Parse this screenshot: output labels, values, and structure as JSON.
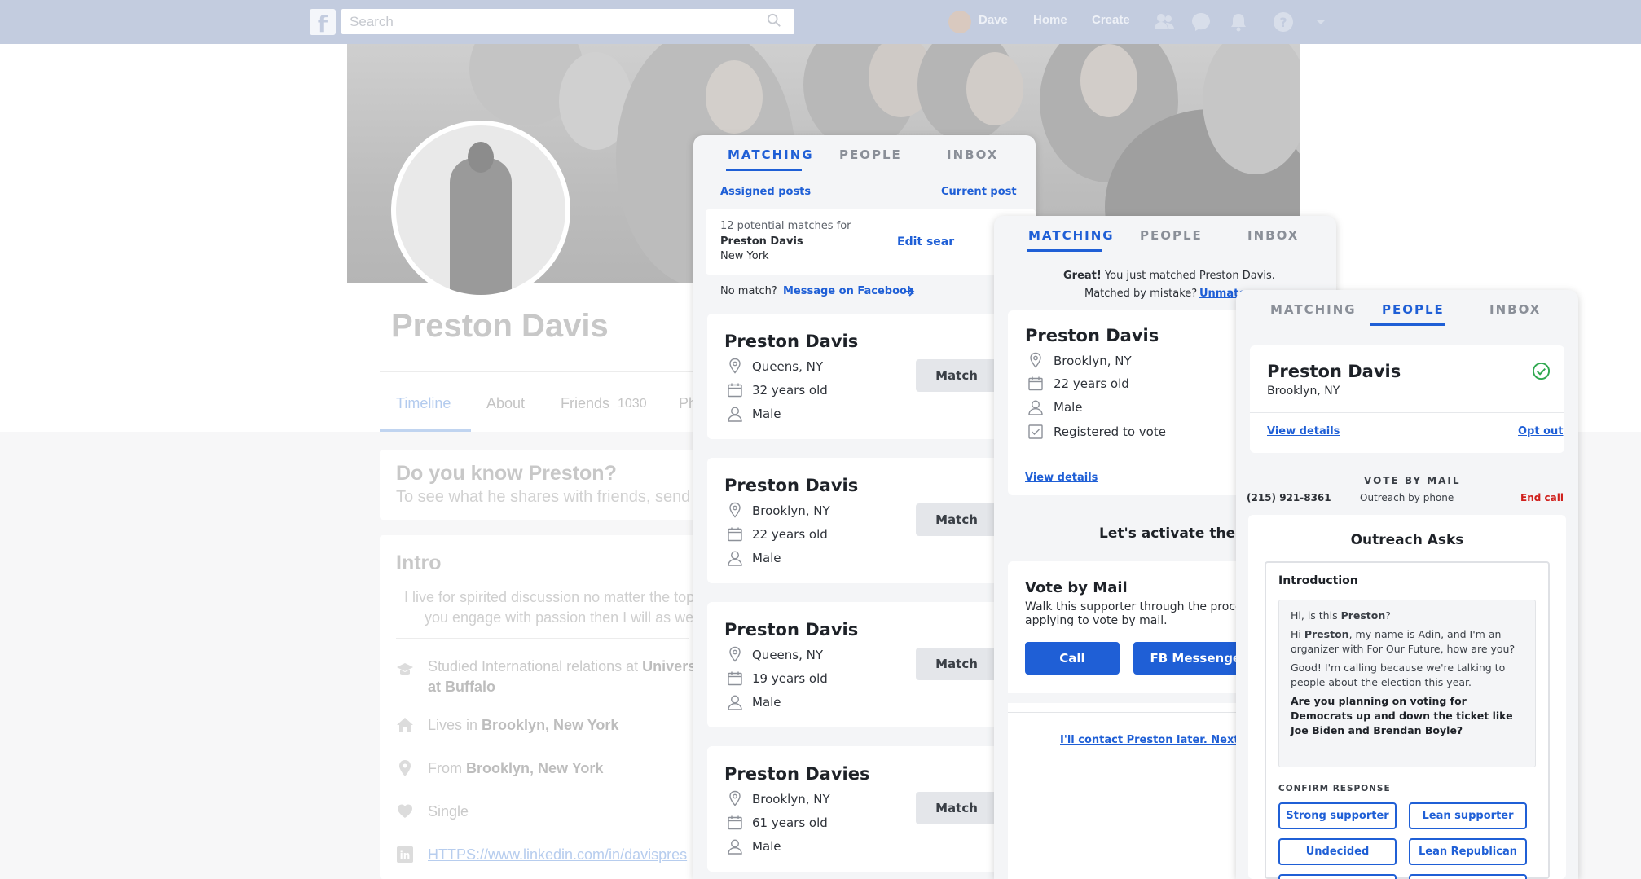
{
  "facebook": {
    "logo": "f",
    "search_placeholder": "Search",
    "nav_user": "Dave",
    "nav_home": "Home",
    "nav_create": "Create",
    "profile_name": "Preston Davis",
    "tabs": {
      "timeline": "Timeline",
      "about": "About",
      "friends": "Friends",
      "friends_count": "1030",
      "photos_partial": "Ph"
    },
    "know_title": "Do you know Preston?",
    "know_sub": "To see what he shares with friends, send",
    "intro_title": "Intro",
    "intro_line1": "I live for spirited discussion no matter the top",
    "intro_line2": "you engage with passion then I will as we",
    "studied_prefix": "Studied International relations at ",
    "studied_bold1": "Univers",
    "studied_bold2": "at Buffalo",
    "lives_prefix": "Lives in ",
    "lives_bold": "Brooklyn, New York",
    "from_prefix": "From ",
    "from_bold": "Brooklyn, New York",
    "relationship": "Single",
    "linkedin": "HTTPS://www.linkedin.com/in/davispres"
  },
  "panel1": {
    "tabs": [
      "MATCHING",
      "PEOPLE",
      "INBOX"
    ],
    "assigned_posts": "Assigned posts",
    "current_post": "Current post",
    "potential_matches": "12 potential matches for",
    "search_name": "Preston Davis",
    "search_city": "New York",
    "edit_search": "Edit sear",
    "no_match": "No match?",
    "message_fb": "Message on Facebook",
    "results": [
      {
        "name": "Preston Davis",
        "location": "Queens, NY",
        "age": "32 years old",
        "gender": "Male",
        "button": "Match"
      },
      {
        "name": "Preston Davis",
        "location": "Brooklyn, NY",
        "age": "22 years old",
        "gender": "Male",
        "button": "Match"
      },
      {
        "name": "Preston Davis",
        "location": "Queens, NY",
        "age": "19 years old",
        "gender": "Male",
        "button": "Match"
      },
      {
        "name": "Preston Davies",
        "location": "Brooklyn, NY",
        "age": "61 years old",
        "gender": "Male",
        "button": "Match"
      }
    ]
  },
  "panel2": {
    "tabs": [
      "MATCHING",
      "PEOPLE",
      "INBOX"
    ],
    "great": "Great!",
    "matched_msg": " You just matched Preston Davis.",
    "mistake": "Matched by mistake?",
    "unmatch": "Unmatc",
    "name": "Preston Davis",
    "location": "Brooklyn, NY",
    "age": "22 years old",
    "gender": "Male",
    "registered": "Registered to vote",
    "view_details": "View details",
    "activate_title": "Let's activate them",
    "vbm_title": "Vote by Mail",
    "vbm_desc1": "Walk this supporter through the proce",
    "vbm_desc2": "applying to vote by mail.",
    "call_btn": "Call",
    "fb_btn": "FB Messenger",
    "later_link": "I'll contact Preston later. Next Ma"
  },
  "panel3": {
    "tabs": [
      "MATCHING",
      "PEOPLE",
      "INBOX"
    ],
    "name": "Preston Davis",
    "location": "Brooklyn, NY",
    "view_details": "View details",
    "opt_out": "Opt out",
    "vbm_label": "VOTE BY MAIL",
    "phone": "(215) 921-8361",
    "outreach_phone": "Outreach by phone",
    "end_call": "End call",
    "asks_title": "Outreach Asks",
    "intro_title": "Introduction",
    "script_q1_a": "Hi, is this ",
    "script_q1_b": "Preston",
    "script_q1_c": "?",
    "script_p2_a": "Hi ",
    "script_p2_b": "Preston",
    "script_p2_c": ", my name is Adin, and I'm an organizer with For Our Future, how are you?",
    "script_p3": "Good! I'm calling because we're talking to people about the election this year.",
    "script_p4": "Are you planning on voting for Democrats up and down the ticket like Joe Biden and Brendan Boyle?",
    "confirm_label": "CONFIRM RESPONSE",
    "responses": [
      "Strong supporter",
      "Lean supporter",
      "Undecided",
      "Lean Republican"
    ]
  },
  "colors": {
    "accent": "#1f5fd6",
    "fb_topbar": "#c3ccdf",
    "end_call": "#d0201c",
    "check": "#2fa84f"
  }
}
